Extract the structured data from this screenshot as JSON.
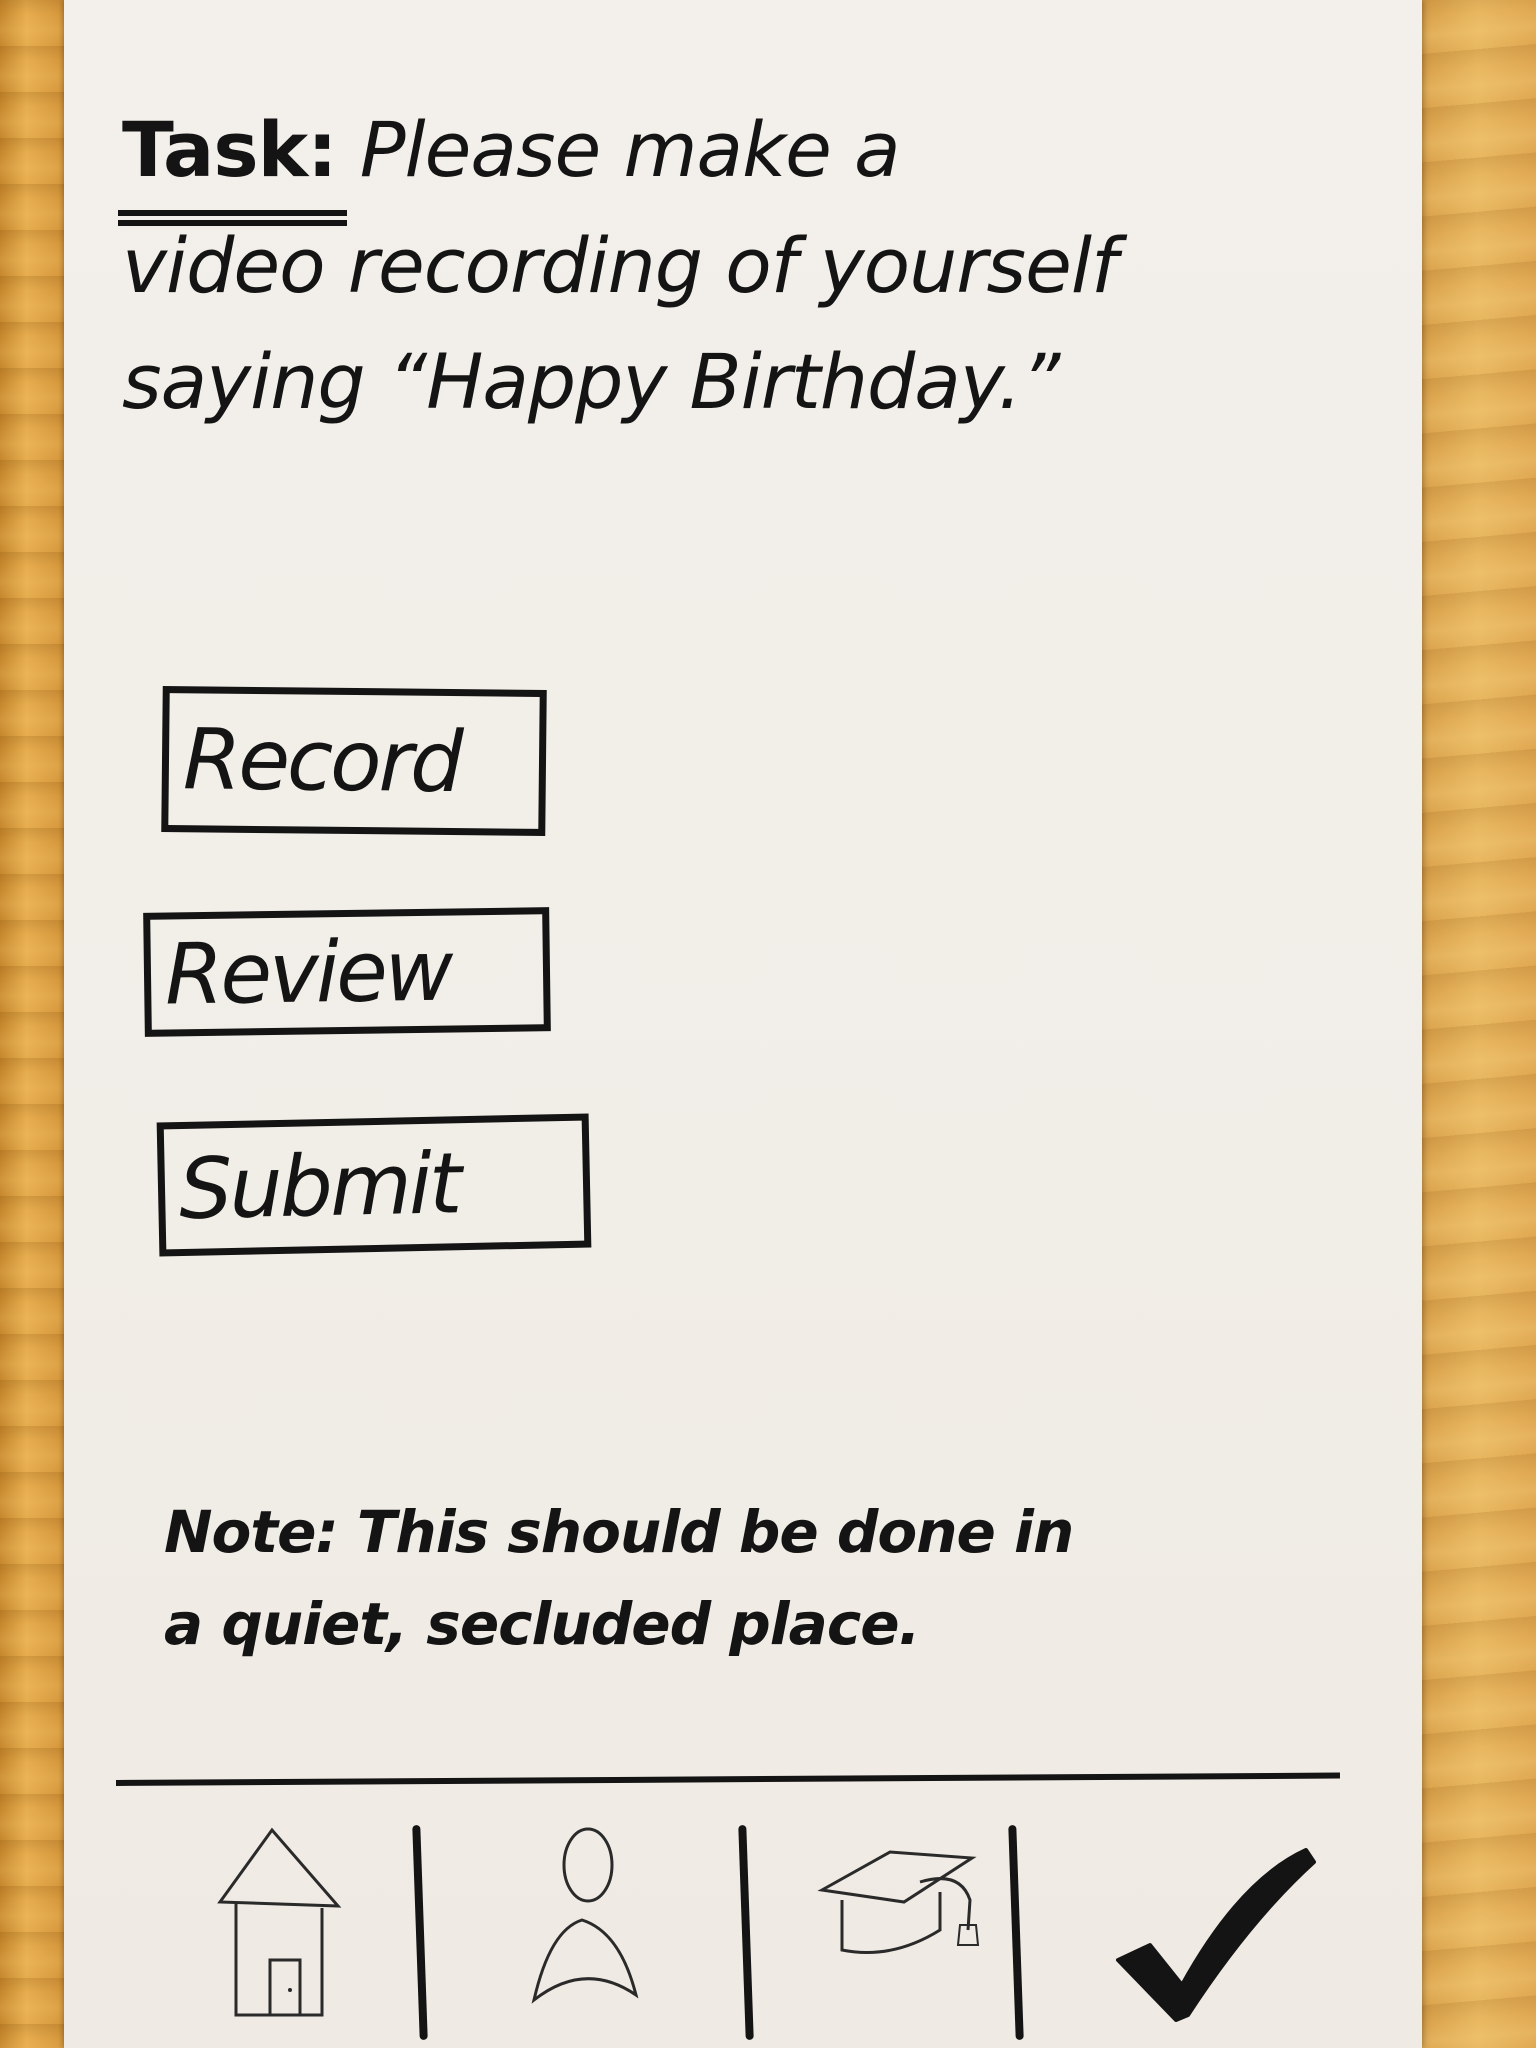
{
  "task": {
    "label": "Task:",
    "line1_rest": "Please make a",
    "line2": "video recording of yourself",
    "line3": "saying “Happy Birthday.”"
  },
  "buttons": {
    "record_label": "Record",
    "review_label": "Review",
    "submit_label": "Submit"
  },
  "note": {
    "line1": "Note: This should be done in",
    "line2": "a quiet, secluded place."
  },
  "tabbar": {
    "items": [
      {
        "icon": "home-icon"
      },
      {
        "icon": "profile-icon"
      },
      {
        "icon": "graduation-cap-icon"
      },
      {
        "icon": "checkmark-icon"
      }
    ]
  },
  "colors": {
    "ink": "#141414",
    "paper": "#f1ede7",
    "wood": "#dfa650"
  }
}
